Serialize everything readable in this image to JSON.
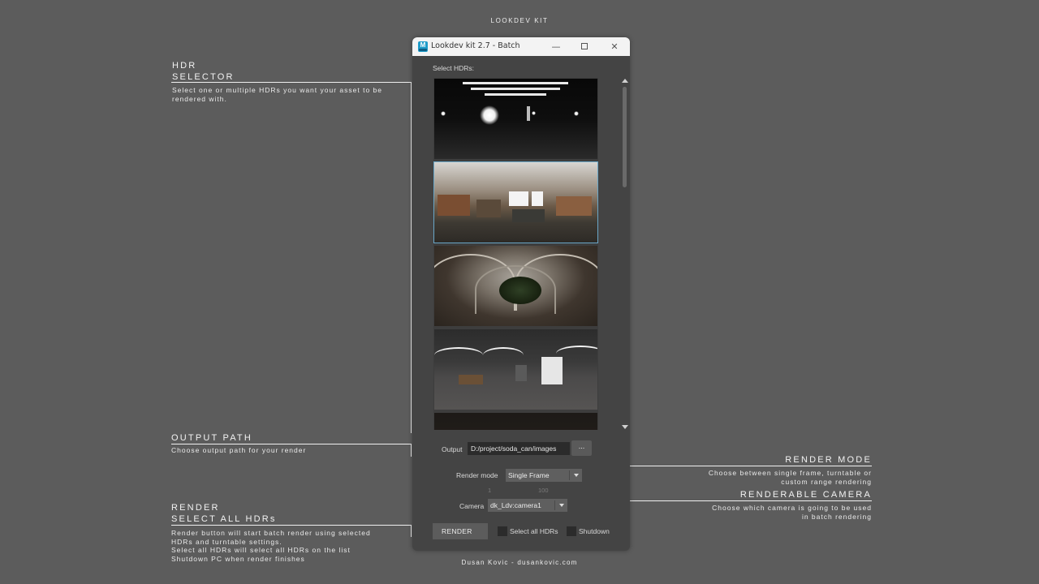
{
  "page": {
    "top_title": "LOOKDEV KIT",
    "footer": "Dusan Kovic - dusankovic.com"
  },
  "annotations": {
    "hdr_selector": {
      "heading_1": "HDR",
      "heading_2": "SELECTOR",
      "desc_1": "Select one or multiple HDRs you want your asset to be",
      "desc_2": "rendered with."
    },
    "output_path": {
      "heading": "OUTPUT PATH",
      "desc": "Choose output path for your render"
    },
    "render": {
      "heading_1": "RENDER",
      "heading_2": "SELECT ALL HDRs",
      "desc_1": "Render button will start batch render using selected",
      "desc_2": "HDRs and turntable settings.",
      "desc_3": "Select all HDRs will select all HDRs on the list",
      "desc_4": "Shutdown PC when render finishes"
    },
    "render_mode": {
      "heading": "RENDER MODE",
      "desc_1": "Choose between single frame, turntable or",
      "desc_2": "custom range rendering"
    },
    "renderable_camera": {
      "heading": "RENDERABLE CAMERA",
      "desc_1": "Choose which camera is going to be used",
      "desc_2": "in batch rendering"
    }
  },
  "window": {
    "app_icon": "maya-icon",
    "title": "Lookdev kit 2.7 - Batch",
    "select_label": "Select HDRs:",
    "hdr_items": [
      {
        "icon": "hdr-thumbnail",
        "selected": false
      },
      {
        "icon": "hdr-thumbnail",
        "selected": true
      },
      {
        "icon": "hdr-thumbnail",
        "selected": false
      },
      {
        "icon": "hdr-thumbnail",
        "selected": false
      },
      {
        "icon": "hdr-thumbnail",
        "selected": false
      }
    ],
    "output_label": "Output",
    "output_value": "D:/project/soda_can/images",
    "browse_label": "...",
    "render_mode_label": "Render mode",
    "render_mode_value": "Single Frame",
    "range_start": "1",
    "range_end": "100",
    "camera_label": "Camera",
    "camera_value": "dk_Ldv:camera1",
    "render_button": "RENDER",
    "select_all_label": "Select all HDRs",
    "select_all_checked": false,
    "shutdown_label": "Shutdown",
    "shutdown_checked": false
  },
  "colors": {
    "background": "#5c5c5c",
    "window_bg": "#444444",
    "selection": "#6aa7c8",
    "app_icon": "#1f9cc9"
  }
}
